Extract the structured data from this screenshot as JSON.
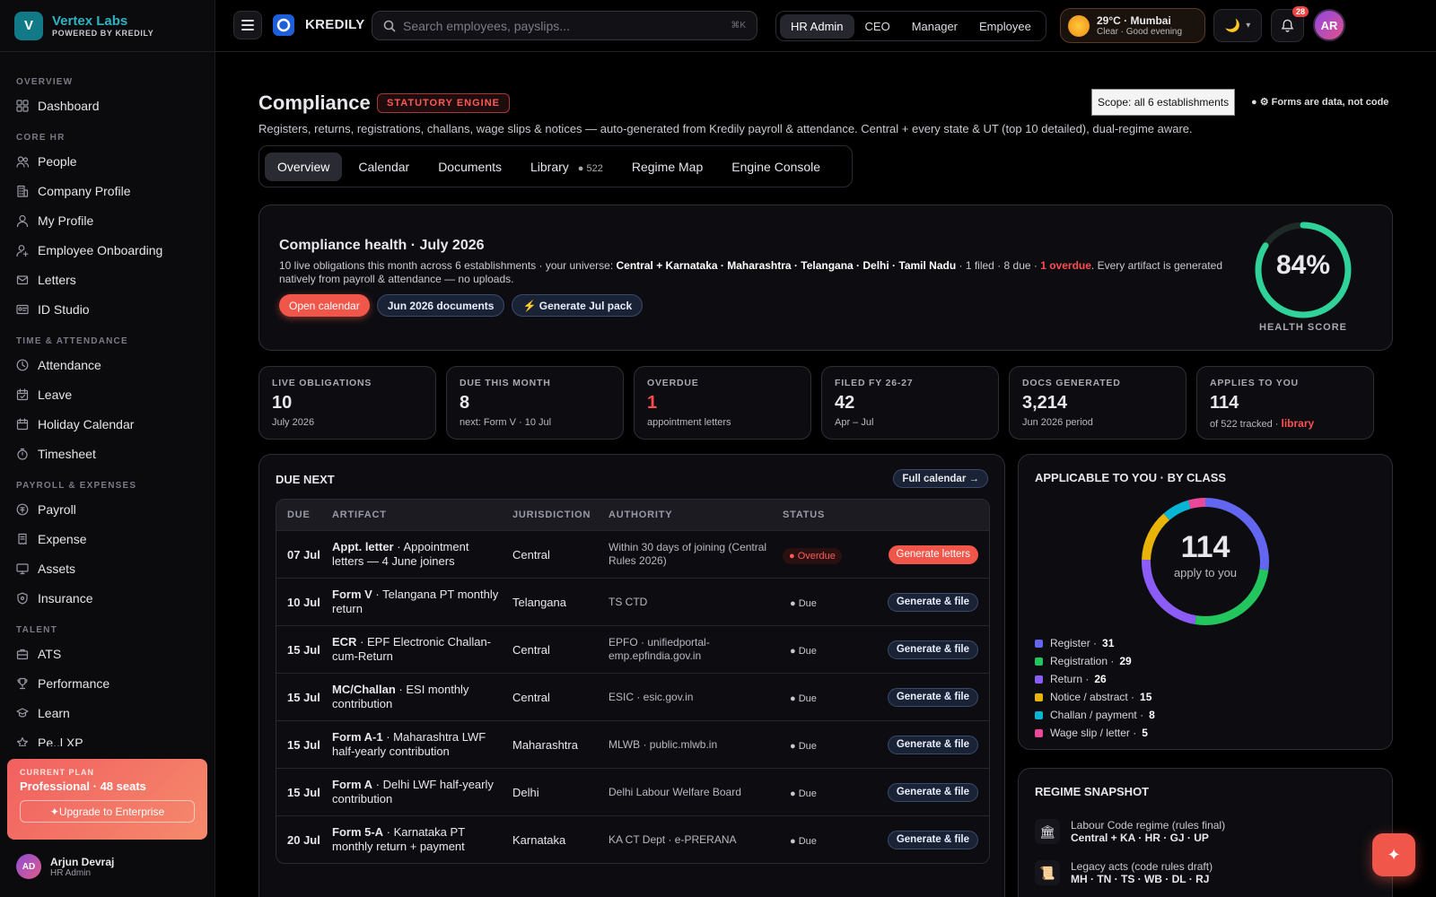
{
  "brand": {
    "name": "Vertex Labs",
    "sub": "POWERED BY KREDILY",
    "initial": "V"
  },
  "sidebar": {
    "sections": [
      {
        "title": "OVERVIEW",
        "items": [
          {
            "label": "Dashboard",
            "icon": "grid-icon"
          }
        ]
      },
      {
        "title": "CORE HR",
        "items": [
          {
            "label": "People",
            "icon": "people-icon"
          },
          {
            "label": "Company Profile",
            "icon": "building-icon"
          },
          {
            "label": "My Profile",
            "icon": "user-icon"
          },
          {
            "label": "Employee Onboarding",
            "icon": "user-plus-icon"
          },
          {
            "label": "Letters",
            "icon": "mail-icon"
          },
          {
            "label": "ID Studio",
            "icon": "id-card-icon"
          }
        ]
      },
      {
        "title": "TIME & ATTENDANCE",
        "items": [
          {
            "label": "Attendance",
            "icon": "clock-icon"
          },
          {
            "label": "Leave",
            "icon": "calendar-check-icon"
          },
          {
            "label": "Holiday Calendar",
            "icon": "calendar-icon"
          },
          {
            "label": "Timesheet",
            "icon": "timer-icon"
          }
        ]
      },
      {
        "title": "PAYROLL & EXPENSES",
        "items": [
          {
            "label": "Payroll",
            "icon": "coin-icon"
          },
          {
            "label": "Expense",
            "icon": "receipt-icon"
          },
          {
            "label": "Assets",
            "icon": "monitor-icon"
          },
          {
            "label": "Insurance",
            "icon": "shield-icon"
          }
        ]
      },
      {
        "title": "TALENT",
        "items": [
          {
            "label": "ATS",
            "icon": "briefcase-icon"
          },
          {
            "label": "Performance",
            "icon": "trophy-icon"
          },
          {
            "label": "Learn",
            "icon": "graduation-icon"
          },
          {
            "label": "Pe..l XP",
            "icon": "star-icon"
          }
        ]
      }
    ],
    "plan": {
      "kicker": "CURRENT PLAN",
      "value": "Professional · 48 seats",
      "upgrade": "✦Upgrade to Enterprise"
    },
    "user": {
      "initials": "AD",
      "name": "Arjun Devraj",
      "role": "HR Admin"
    }
  },
  "topbar": {
    "brand": "KREDILY",
    "search_placeholder": "Search employees, payslips...",
    "search_kbd": "⌘K",
    "roles": [
      "HR Admin",
      "CEO",
      "Manager",
      "Employee"
    ],
    "weather_line1": "29°C · Mumbai",
    "weather_line2": "Clear · Good evening",
    "theme_icon": "🌙",
    "notif_count": "28",
    "avatar": "AR"
  },
  "page": {
    "title": "Compliance",
    "tag": "STATUTORY ENGINE",
    "scope": "Scope: all 6 establishments",
    "forms_note": "● ⚙ Forms are data, not code",
    "subtitle": "Registers, returns, registrations, challans, wage slips & notices — auto-generated from Kredily payroll & attendance. Central + every state & UT (top 10 detailed), dual-regime aware.",
    "tabs": [
      {
        "label": "Overview",
        "count": ""
      },
      {
        "label": "Calendar",
        "count": ""
      },
      {
        "label": "Documents",
        "count": ""
      },
      {
        "label": "Library",
        "count": "● 522"
      },
      {
        "label": "Regime Map",
        "count": ""
      },
      {
        "label": "Engine Console",
        "count": ""
      }
    ]
  },
  "health": {
    "title": "Compliance health · July 2026",
    "desc_prefix": "10 live obligations this month across 6 establishments · your universe: ",
    "desc_universe": "Central + Karnataka · Maharashtra · Telangana · Delhi · Tamil Nadu",
    "desc_mid": " · 1 filed · 8 due · ",
    "desc_overdue": "1 overdue",
    "desc_suffix": ". Every artifact is generated natively from payroll & attendance — no uploads.",
    "btn_calendar": "Open calendar",
    "btn_docs": "Jun 2026 documents",
    "btn_pack": "⚡ Generate Jul pack",
    "score": "84%",
    "score_value": 84,
    "score_label": "HEALTH SCORE",
    "ring_color": "#2fd39a"
  },
  "kpis": [
    {
      "label": "LIVE OBLIGATIONS",
      "value": "10",
      "sub": "July 2026",
      "red": false
    },
    {
      "label": "DUE THIS MONTH",
      "value": "8",
      "sub": "next: Form V · 10 Jul",
      "red": false
    },
    {
      "label": "OVERDUE",
      "value": "1",
      "sub": "appointment letters",
      "red": true
    },
    {
      "label": "FILED FY 26-27",
      "value": "42",
      "sub": "Apr – Jul",
      "red": false
    },
    {
      "label": "DOCS GENERATED",
      "value": "3,214",
      "sub": "Jun 2026 period",
      "red": false
    },
    {
      "label": "APPLIES TO YOU",
      "value": "114",
      "sub": "of 522 tracked · ",
      "sub_link": "library",
      "red": false
    }
  ],
  "due_next": {
    "title": "DUE NEXT",
    "full_calendar": "Full calendar →",
    "headers": [
      "DUE",
      "ARTIFACT",
      "JURISDICTION",
      "AUTHORITY",
      "STATUS"
    ],
    "rows": [
      {
        "due": "07 Jul",
        "code": "Appt. letter",
        "desc": " · Appointment letters — 4 June joiners",
        "juris": "Central",
        "auth": "Within 30 days of joining (Central Rules 2026)",
        "status": "● Overdue",
        "overdue": true,
        "action": "Generate letters"
      },
      {
        "due": "10 Jul",
        "code": "Form V",
        "desc": " · Telangana PT monthly return",
        "juris": "Telangana",
        "auth": "TS CTD",
        "status": "● Due",
        "overdue": false,
        "action": "Generate & file"
      },
      {
        "due": "15 Jul",
        "code": "ECR",
        "desc": " · EPF Electronic Challan-cum-Return",
        "juris": "Central",
        "auth": "EPFO · unifiedportal-emp.epfindia.gov.in",
        "status": "● Due",
        "overdue": false,
        "action": "Generate & file"
      },
      {
        "due": "15 Jul",
        "code": "MC/Challan",
        "desc": " · ESI monthly contribution",
        "juris": "Central",
        "auth": "ESIC · esic.gov.in",
        "status": "● Due",
        "overdue": false,
        "action": "Generate & file"
      },
      {
        "due": "15 Jul",
        "code": "Form A-1",
        "desc": " · Maharashtra LWF half-yearly contribution",
        "juris": "Maharashtra",
        "auth": "MLWB · public.mlwb.in",
        "status": "● Due",
        "overdue": false,
        "action": "Generate & file"
      },
      {
        "due": "15 Jul",
        "code": "Form A",
        "desc": " · Delhi LWF half-yearly contribution",
        "juris": "Delhi",
        "auth": "Delhi Labour Welfare Board",
        "status": "● Due",
        "overdue": false,
        "action": "Generate & file"
      },
      {
        "due": "20 Jul",
        "code": "Form 5-A",
        "desc": " · Karnataka PT monthly return + payment",
        "juris": "Karnataka",
        "auth": "KA CT Dept · e-PRERANA",
        "status": "● Due",
        "overdue": false,
        "action": "Generate & file"
      }
    ]
  },
  "applicable": {
    "title": "APPLICABLE TO YOU · BY CLASS",
    "total": "114",
    "total_label": "apply to you",
    "classes": [
      {
        "name": "Register",
        "count": 31,
        "color": "#6366f1"
      },
      {
        "name": "Registration",
        "count": 29,
        "color": "#22c55e"
      },
      {
        "name": "Return",
        "count": 26,
        "color": "#8b5cf6"
      },
      {
        "name": "Notice / abstract",
        "count": 15,
        "color": "#eab308"
      },
      {
        "name": "Challan / payment",
        "count": 8,
        "color": "#06b6d4"
      },
      {
        "name": "Wage slip / letter",
        "count": 5,
        "color": "#ec4899"
      }
    ]
  },
  "regime": {
    "title": "REGIME SNAPSHOT",
    "rows": [
      {
        "icon": "🏛",
        "a": "Labour Code regime (rules final)",
        "b": "Central + KA · HR · GJ · UP"
      },
      {
        "icon": "📜",
        "a": "Legacy acts (code rules draft)",
        "b": "MH · TN · TS · WB · DL · RJ"
      }
    ]
  },
  "fab_icon": "✦"
}
